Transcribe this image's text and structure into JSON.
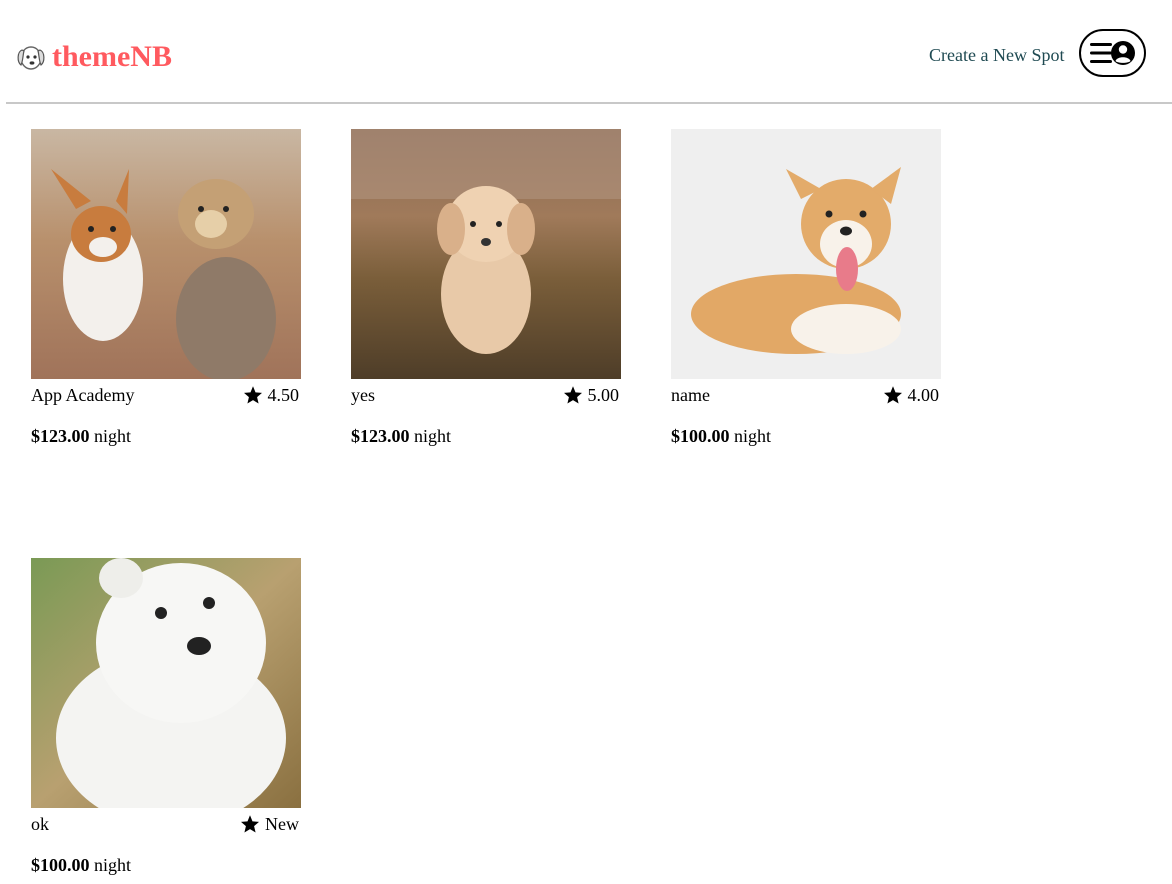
{
  "brand": {
    "name": "themeNB",
    "color": "#ff5a5f",
    "icon": "dog-head-icon"
  },
  "nav": {
    "create_spot": "Create a New Spot",
    "menu_icons": [
      "hamburger-icon",
      "user-circle-icon"
    ]
  },
  "spots": [
    {
      "name": "App Academy",
      "rating": "4.50",
      "price": "$123.00",
      "price_unit": "night",
      "image": "corgi-and-yorkie-running-photo"
    },
    {
      "name": "yes",
      "rating": "5.00",
      "price": "$123.00",
      "price_unit": "night",
      "image": "golden-puppy-running-photo"
    },
    {
      "name": "name",
      "rating": "4.00",
      "price": "$100.00",
      "price_unit": "night",
      "image": "corgi-lying-down-photo"
    },
    {
      "name": "ok",
      "rating": "New",
      "price": "$100.00",
      "price_unit": "night",
      "image": "white-fluffy-puppy-photo"
    }
  ]
}
